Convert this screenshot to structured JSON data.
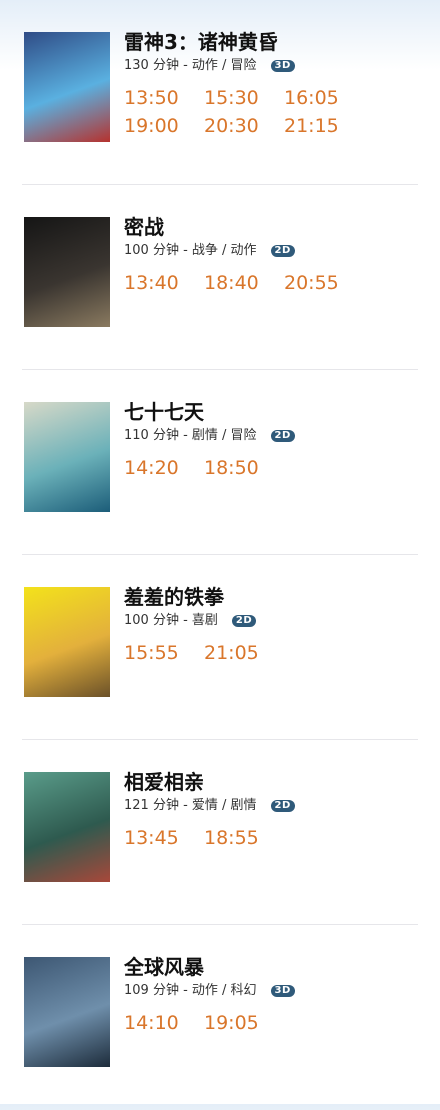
{
  "movies": [
    {
      "title": "雷神3：诸神黄昏",
      "meta": "130 分钟 - 动作 / 冒险",
      "format": "3D",
      "format_color": "#2f5a7a",
      "poster_colors": [
        "#2f4c86",
        "#5ab0e0",
        "#b6322e"
      ],
      "times": [
        "13:50",
        "15:30",
        "16:05",
        "19:00",
        "20:30",
        "21:15"
      ]
    },
    {
      "title": "密战",
      "meta": "100 分钟 - 战争 / 动作",
      "format": "2D",
      "format_color": "#2f5a7a",
      "poster_colors": [
        "#151515",
        "#3a3530",
        "#8a7a60"
      ],
      "times": [
        "13:40",
        "18:40",
        "20:55"
      ]
    },
    {
      "title": "七十七天",
      "meta": "110 分钟 - 剧情 / 冒险",
      "format": "2D",
      "format_color": "#2f5a7a",
      "poster_colors": [
        "#d7d9c8",
        "#6bb1b9",
        "#1c5d79"
      ],
      "times": [
        "14:20",
        "18:50"
      ]
    },
    {
      "title": "羞羞的铁拳",
      "meta": "100 分钟 - 喜剧",
      "format": "2D",
      "format_color": "#2f5a7a",
      "poster_colors": [
        "#f3e21b",
        "#e3b03c",
        "#6b5129"
      ],
      "times": [
        "15:55",
        "21:05"
      ]
    },
    {
      "title": "相爱相亲",
      "meta": "121 分钟 - 爱情 / 剧情",
      "format": "2D",
      "format_color": "#2f5a7a",
      "poster_colors": [
        "#5a9c8a",
        "#2e5a4f",
        "#a8483a"
      ],
      "times": [
        "13:45",
        "18:55"
      ]
    },
    {
      "title": "全球风暴",
      "meta": "109 分钟 - 动作 / 科幻",
      "format": "3D",
      "format_color": "#2f5a7a",
      "poster_colors": [
        "#3d5773",
        "#6f8fab",
        "#1d2c3b"
      ],
      "times": [
        "14:10",
        "19:05"
      ]
    }
  ]
}
